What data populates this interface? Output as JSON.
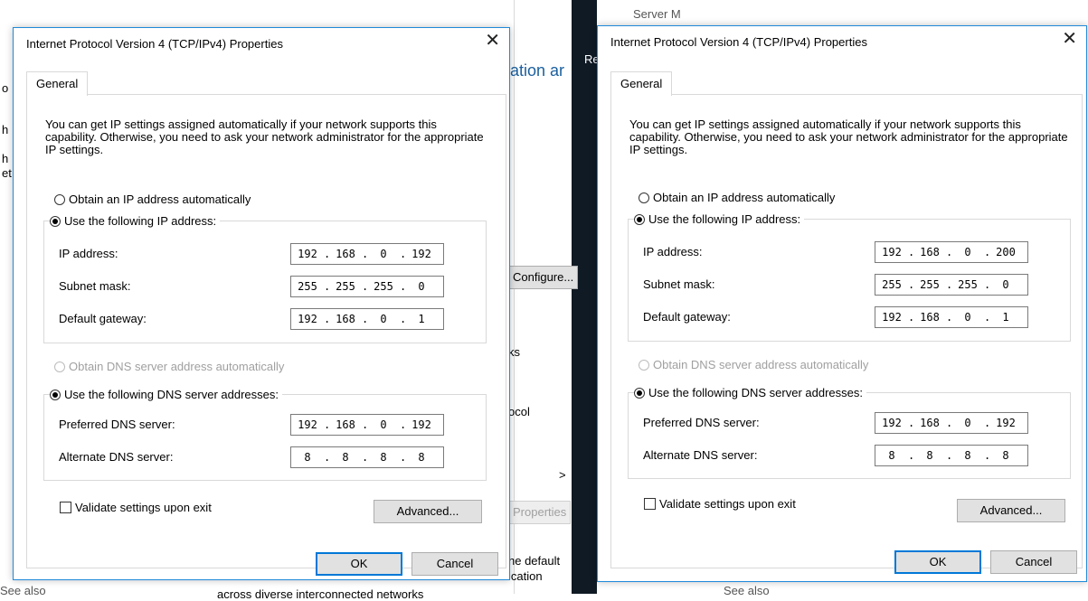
{
  "background": {
    "server_manager": "Server M",
    "partial_heading": "ation ar",
    "re": "Re",
    "configure": "Configure...",
    "frag_ks": "ks",
    "frag_ocol": "ocol",
    "chevron": ">",
    "properties": "Properties",
    "frag_default": "he default",
    "frag_ication": "ication",
    "frag_bottom": "across diverse interconnected networks",
    "see_also_left": "See also",
    "see_also_right": "See also",
    "frag_o": "o",
    "frag_h1": "h",
    "frag_h2": "h",
    "frag_et": "et"
  },
  "dialogs": [
    {
      "title": "Internet Protocol Version 4 (TCP/IPv4) Properties",
      "tab": "General",
      "description": "You can get IP settings assigned automatically if your network supports this capability. Otherwise, you need to ask your network administrator for the appropriate IP settings.",
      "obtain_ip_auto": "Obtain an IP address automatically",
      "use_following_ip": "Use the following IP address:",
      "ip_label": "IP address:",
      "ip": [
        "192",
        "168",
        "0",
        "192"
      ],
      "subnet_label": "Subnet mask:",
      "subnet": [
        "255",
        "255",
        "255",
        "0"
      ],
      "gateway_label": "Default gateway:",
      "gateway": [
        "192",
        "168",
        "0",
        "1"
      ],
      "obtain_dns_auto": "Obtain DNS server address automatically",
      "use_following_dns": "Use the following DNS server addresses:",
      "preferred_label": "Preferred DNS server:",
      "preferred": [
        "192",
        "168",
        "0",
        "192"
      ],
      "alternate_label": "Alternate DNS server:",
      "alternate": [
        "8",
        "8",
        "8",
        "8"
      ],
      "validate": "Validate settings upon exit",
      "advanced": "Advanced...",
      "ok": "OK",
      "cancel": "Cancel",
      "close": "✕"
    },
    {
      "title": "Internet Protocol Version 4 (TCP/IPv4) Properties",
      "tab": "General",
      "description": "You can get IP settings assigned automatically if your network supports this capability. Otherwise, you need to ask your network administrator for the appropriate IP settings.",
      "obtain_ip_auto": "Obtain an IP address automatically",
      "use_following_ip": "Use the following IP address:",
      "ip_label": "IP address:",
      "ip": [
        "192",
        "168",
        "0",
        "200"
      ],
      "subnet_label": "Subnet mask:",
      "subnet": [
        "255",
        "255",
        "255",
        "0"
      ],
      "gateway_label": "Default gateway:",
      "gateway": [
        "192",
        "168",
        "0",
        "1"
      ],
      "obtain_dns_auto": "Obtain DNS server address automatically",
      "use_following_dns": "Use the following DNS server addresses:",
      "preferred_label": "Preferred DNS server:",
      "preferred": [
        "192",
        "168",
        "0",
        "192"
      ],
      "alternate_label": "Alternate DNS server:",
      "alternate": [
        "8",
        "8",
        "8",
        "8"
      ],
      "validate": "Validate settings upon exit",
      "advanced": "Advanced...",
      "ok": "OK",
      "cancel": "Cancel",
      "close": "✕"
    }
  ]
}
